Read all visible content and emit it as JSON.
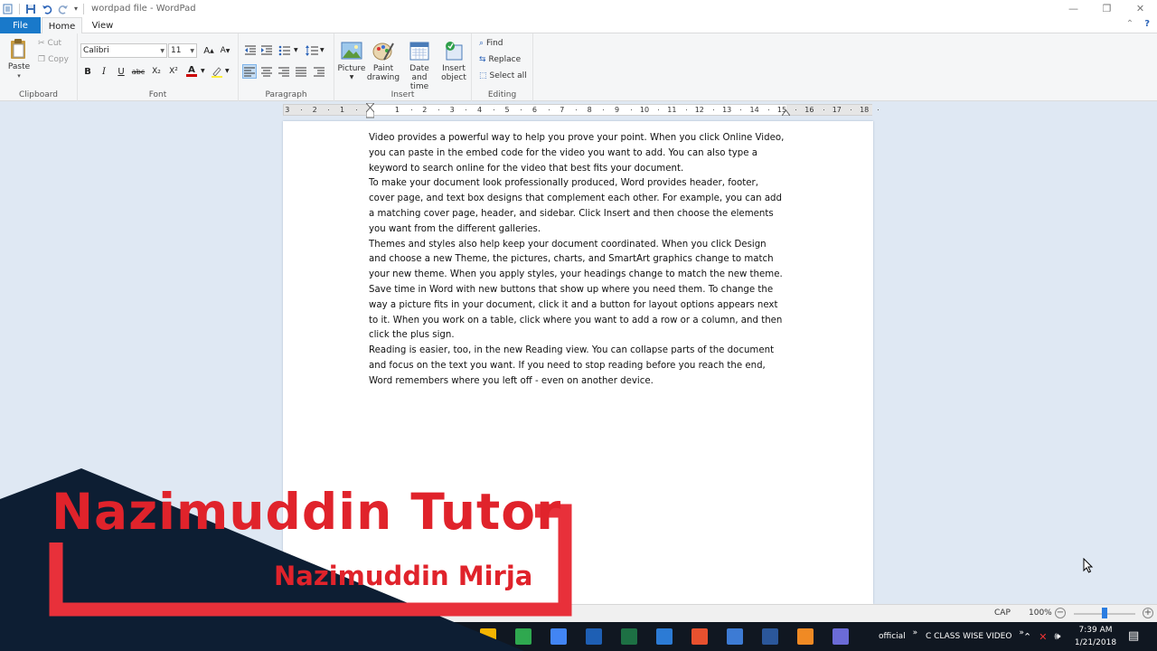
{
  "window": {
    "title": "wordpad file - WordPad",
    "controls": [
      "—",
      "❐",
      "✕"
    ]
  },
  "tabs": {
    "file": "File",
    "home": "Home",
    "view": "View"
  },
  "ribbon": {
    "clipboard": {
      "label": "Clipboard",
      "paste": "Paste",
      "cut": "Cut",
      "copy": "Copy"
    },
    "font": {
      "label": "Font",
      "family": "Calibri",
      "size": "11",
      "bold": "B",
      "italic": "I",
      "underline": "U",
      "strike": "abc",
      "sub": "X₂",
      "sup": "X²",
      "color": "A"
    },
    "paragraph": {
      "label": "Paragraph"
    },
    "insert": {
      "label": "Insert",
      "picture": "Picture",
      "paint1": "Paint",
      "paint2": "drawing",
      "date1": "Date and",
      "date2": "time",
      "obj1": "Insert",
      "obj2": "object"
    },
    "editing": {
      "label": "Editing",
      "find": "Find",
      "replace": "Replace",
      "select_all": "Select all"
    }
  },
  "ruler": {
    "ticks": [
      "3",
      "2",
      "1",
      "1",
      "2",
      "3",
      "4",
      "5",
      "6",
      "7",
      "8",
      "9",
      "10",
      "11",
      "12",
      "13",
      "14",
      "15",
      "16",
      "17",
      "18"
    ]
  },
  "document": {
    "paragraphs": [
      "Video provides a powerful way to help you prove your point. When you click Online Video, you can paste in the embed code for the video you want to add. You can also type a keyword to search online for the video that best fits your document.",
      "To make your document look professionally produced, Word provides header, footer, cover page, and text box designs that complement each other. For example, you can add a matching cover page, header, and sidebar. Click Insert and then choose the elements you want from the different galleries.",
      "Themes and styles also help keep your document coordinated. When you click Design and choose a new Theme, the pictures, charts, and SmartArt graphics change to match your new theme. When you apply styles, your headings change to match the new theme.",
      "Save time in Word with new buttons that show up where you need them. To change the way a picture fits in your document, click it and a button for layout options appears next to it. When you work on a table, click where you want to add a row or a column, and then click the plus sign.",
      "Reading is easier, too, in the new Reading view. You can collapse parts of the document and focus on the text you want. If you need to stop reading before you reach the end, Word remembers where you left off - even on another device."
    ]
  },
  "status": {
    "cap": "CAP",
    "zoom": "100%",
    "zoom_minus": "−",
    "zoom_plus": "+"
  },
  "zoom_fraction": 0.5,
  "taskbar": {
    "tray_official": "official",
    "tray_folder": "C CLASS WISE VIDEO",
    "time": "7:39 AM",
    "date": "1/21/2018",
    "app_colors": [
      "#f4b400",
      "#2fa84f",
      "#4285f4",
      "#1e5fb4",
      "#1d7044",
      "#2c7bd5",
      "#e8512f",
      "#3d7bd4",
      "#2b579a",
      "#f08a24",
      "#6b6bd6"
    ]
  },
  "watermark": {
    "title": "Nazimuddin Tutor",
    "subtitle": "Nazimuddin Mirja"
  },
  "colors": {
    "accent": "#1979ca",
    "brand_red": "#e0232b",
    "navy": "#0d1e33"
  }
}
